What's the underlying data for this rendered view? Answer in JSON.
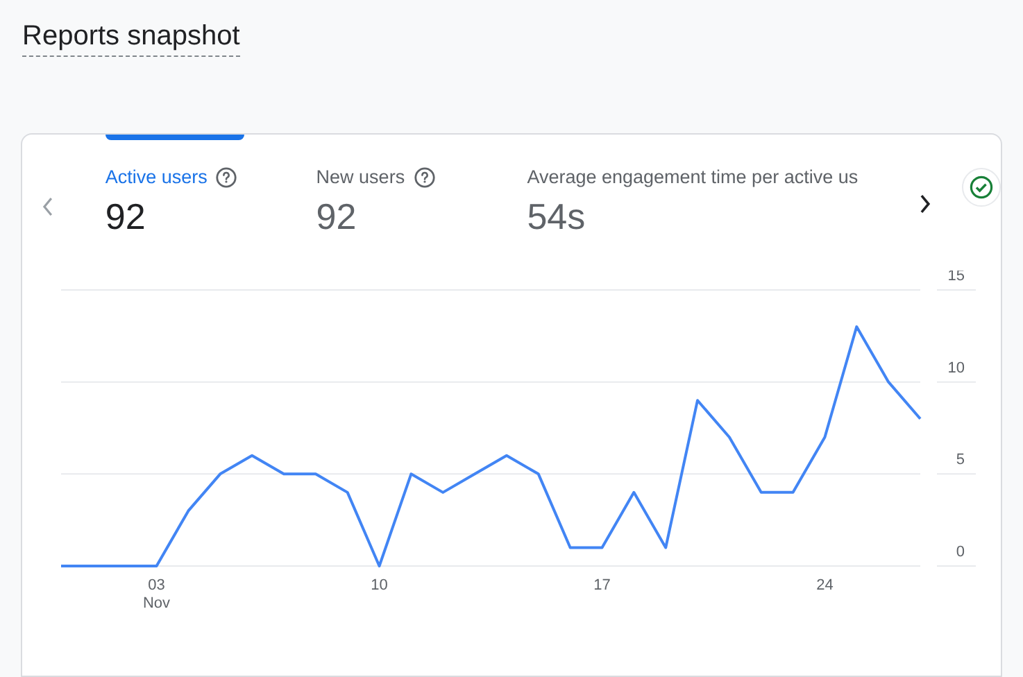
{
  "title": "Reports snapshot",
  "metrics": [
    {
      "label": "Active users",
      "value": "92",
      "selected": true,
      "help": true
    },
    {
      "label": "New users",
      "value": "92",
      "selected": false,
      "help": true
    },
    {
      "label": "Average engagement time per active us",
      "value": "54s",
      "selected": false,
      "help": false
    }
  ],
  "chart_data": {
    "type": "line",
    "x": [
      0,
      1,
      2,
      3,
      4,
      5,
      6,
      7,
      8,
      9,
      10,
      11,
      12,
      13,
      14,
      15,
      16,
      17,
      18,
      19,
      20,
      21,
      22,
      23,
      24,
      25,
      26,
      27
    ],
    "series": [
      {
        "color": "#4285f4",
        "values": [
          0,
          0,
          0,
          0,
          3,
          5,
          6,
          5,
          5,
          4,
          0,
          5,
          4,
          5,
          6,
          5,
          1,
          1,
          4,
          1,
          9,
          7,
          4,
          4,
          7,
          13,
          10,
          8
        ]
      }
    ],
    "xlim": [
      0,
      27
    ],
    "ylim": [
      0,
      15
    ],
    "yticks": [
      0,
      5,
      10,
      15
    ],
    "xticks": [
      {
        "value": 3,
        "label": "03\nNov"
      },
      {
        "value": 10,
        "label": "10"
      },
      {
        "value": 17,
        "label": "17"
      },
      {
        "value": 24,
        "label": "24"
      }
    ]
  }
}
